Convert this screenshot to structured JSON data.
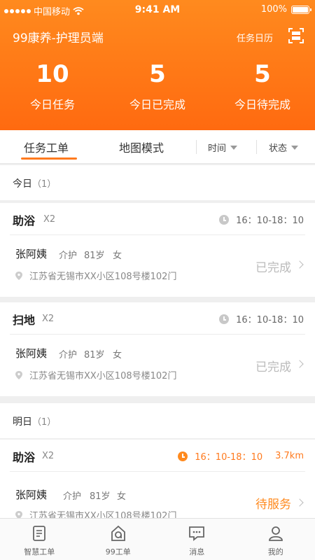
{
  "status_bar": {
    "carrier": "中国移动",
    "time": "9:41 AM",
    "battery": "100%"
  },
  "header": {
    "title": "99康养-护理员端",
    "calendar_link": "任务日历",
    "scan_icon": "scan-icon"
  },
  "stats": [
    {
      "value": "10",
      "label": "今日任务"
    },
    {
      "value": "5",
      "label": "今日已完成"
    },
    {
      "value": "5",
      "label": "今日待完成"
    }
  ],
  "tabs": {
    "work_order": "任务工单",
    "map_mode": "地图模式",
    "filter_time": "时间",
    "filter_status": "状态"
  },
  "sections": {
    "today": {
      "label": "今日",
      "count": "（1）"
    },
    "tomorrow": {
      "label": "明日",
      "count": "（1）"
    }
  },
  "cards": [
    {
      "service": "助浴",
      "mult": "X2",
      "time": "16：10-18：10",
      "distance": "",
      "name": "张阿姨",
      "role": "介护",
      "age": "81岁",
      "gender": "女",
      "address": "江苏省无锡市XX小区108号楼102门",
      "status": "已完成"
    },
    {
      "service": "扫地",
      "mult": "X2",
      "time": "16：10-18：10",
      "distance": "",
      "name": "张阿姨",
      "role": "介护",
      "age": "81岁",
      "gender": "女",
      "address": "江苏省无锡市XX小区108号楼102门",
      "status": "已完成"
    },
    {
      "service": "助浴",
      "mult": "X2",
      "time": "16：10-18：10",
      "distance": "3.7km",
      "name": "张阿姨",
      "role": "介护",
      "age": "81岁",
      "gender": "女",
      "address": "江苏省无锡市XX小区108号楼102门",
      "status": "待服务"
    }
  ],
  "tabbar": [
    {
      "label": "智慧工单",
      "icon": "document-icon"
    },
    {
      "label": "99工单",
      "icon": "house-icon"
    },
    {
      "label": "消息",
      "icon": "message-icon"
    },
    {
      "label": "我的",
      "icon": "person-icon"
    }
  ],
  "colors": {
    "accent": "#ff7a1e",
    "done": "#bbbbbb",
    "pending": "#ff8a1e"
  }
}
